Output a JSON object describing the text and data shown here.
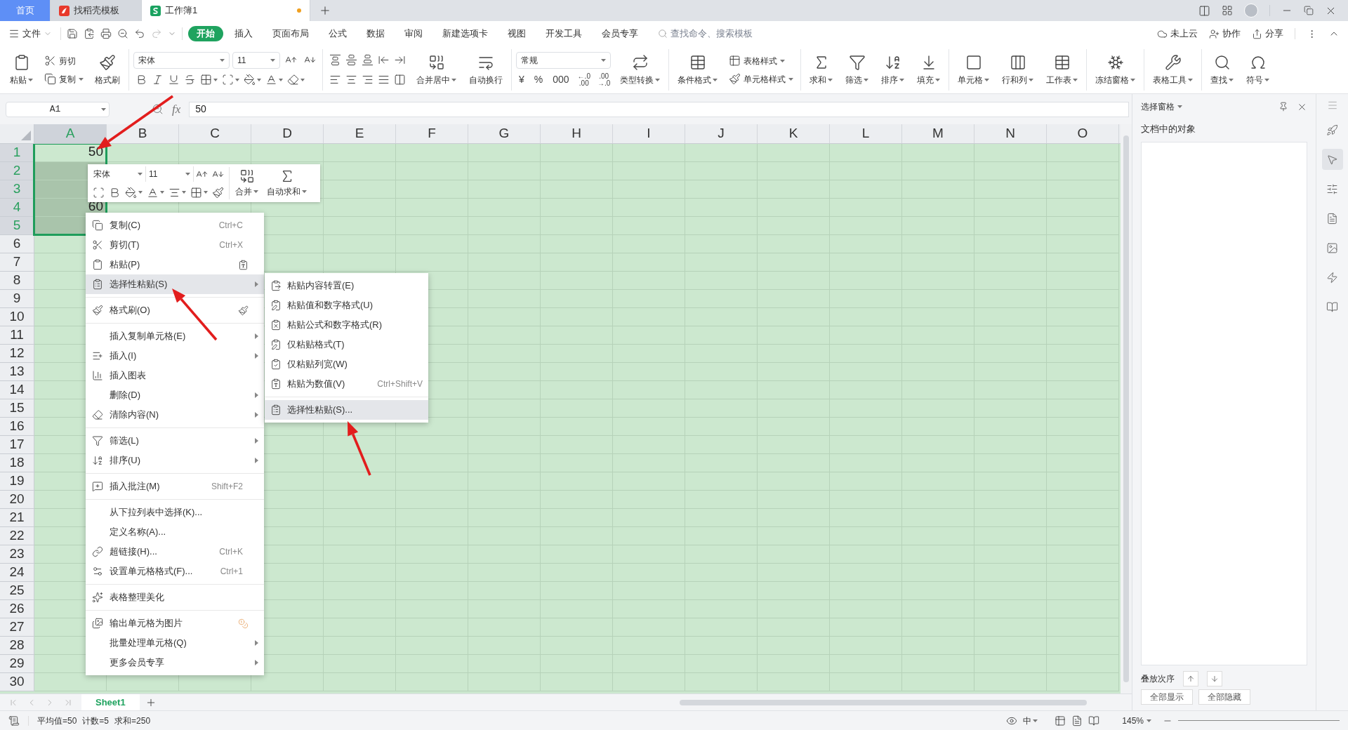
{
  "tabs": [
    {
      "label": "首页",
      "selected": false,
      "kind": "home"
    },
    {
      "label": "找稻壳模板",
      "selected": false,
      "kind": "docer"
    },
    {
      "label": "工作簿1",
      "selected": true,
      "kind": "sheet",
      "unsaved": true
    }
  ],
  "menu_bar": {
    "file": "文件",
    "tabs": [
      {
        "label": "开始",
        "selected": true
      },
      {
        "label": "插入",
        "selected": false
      },
      {
        "label": "页面布局",
        "selected": false
      },
      {
        "label": "公式",
        "selected": false
      },
      {
        "label": "数据",
        "selected": false
      },
      {
        "label": "审阅",
        "selected": false
      },
      {
        "label": "新建选项卡",
        "selected": false
      },
      {
        "label": "视图",
        "selected": false
      },
      {
        "label": "开发工具",
        "selected": false
      },
      {
        "label": "会员专享",
        "selected": false
      }
    ],
    "search": {
      "placeholder": "查找命令、搜索模板"
    },
    "actions": [
      "未上云",
      "协作",
      "分享"
    ]
  },
  "ribbon": {
    "clipboard": [
      {
        "label": "粘贴",
        "has_menu": true
      },
      {
        "label": "剪切",
        "has_menu": false
      },
      {
        "label": "复制",
        "has_menu": true
      },
      {
        "label": "格式刷",
        "has_menu": false
      }
    ],
    "font": {
      "name": "宋体",
      "size": "11"
    },
    "alignment": [
      {
        "label": "合并居中",
        "has_menu": true
      },
      {
        "label": "自动换行",
        "has_menu": false
      }
    ],
    "number": {
      "format": "常规",
      "symbols": [
        "¥",
        "%",
        "000"
      ],
      "decimals": [
        [
          "←.0",
          ".00"
        ],
        [
          ".00",
          "→.0"
        ]
      ],
      "convert": {
        "label": "类型转换",
        "has_menu": true
      }
    },
    "styles": [
      {
        "label": "条件格式",
        "has_menu": true
      },
      {
        "label": "表格样式",
        "has_menu": true
      },
      {
        "label": "单元格样式",
        "has_menu": true
      }
    ],
    "tool_groups": [
      [
        {
          "label": "求和",
          "has_menu": true
        },
        {
          "label": "筛选",
          "has_menu": true
        },
        {
          "label": "排序",
          "has_menu": true
        },
        {
          "label": "填充",
          "has_menu": true
        }
      ],
      [
        {
          "label": "单元格",
          "has_menu": true
        },
        {
          "label": "行和列",
          "has_menu": true
        },
        {
          "label": "工作表",
          "has_menu": true
        }
      ],
      [
        {
          "label": "冻结窗格",
          "has_menu": true
        }
      ],
      [
        {
          "label": "表格工具",
          "has_menu": true
        }
      ],
      [
        {
          "label": "查找",
          "has_menu": true
        },
        {
          "label": "符号",
          "has_menu": true
        }
      ]
    ]
  },
  "formula_bar": {
    "name_box": "A1",
    "function_label": "fx",
    "value": "50"
  },
  "columns": [
    {
      "label": "A",
      "selected": true
    },
    {
      "label": "B",
      "selected": false
    },
    {
      "label": "C",
      "selected": false
    },
    {
      "label": "D",
      "selected": false
    },
    {
      "label": "E",
      "selected": false
    },
    {
      "label": "F",
      "selected": false
    },
    {
      "label": "G",
      "selected": false
    },
    {
      "label": "H",
      "selected": false
    },
    {
      "label": "I",
      "selected": false
    },
    {
      "label": "J",
      "selected": false
    },
    {
      "label": "K",
      "selected": false
    },
    {
      "label": "L",
      "selected": false
    },
    {
      "label": "M",
      "selected": false
    },
    {
      "label": "N",
      "selected": false
    },
    {
      "label": "O",
      "selected": false
    }
  ],
  "rows": [
    {
      "label": "1",
      "selected": true,
      "cells": [
        "50"
      ]
    },
    {
      "label": "2",
      "selected": true
    },
    {
      "label": "3",
      "selected": true
    },
    {
      "label": "4",
      "selected": true,
      "cells": [
        "60"
      ]
    },
    {
      "label": "5",
      "selected": true
    },
    {
      "label": "6",
      "selected": false
    },
    {
      "label": "7",
      "selected": false
    },
    {
      "label": "8",
      "selected": false
    },
    {
      "label": "9",
      "selected": false
    },
    {
      "label": "10",
      "selected": false
    },
    {
      "label": "11",
      "selected": false
    },
    {
      "label": "12",
      "selected": false
    },
    {
      "label": "13",
      "selected": false
    },
    {
      "label": "14",
      "selected": false
    },
    {
      "label": "15",
      "selected": false
    },
    {
      "label": "16",
      "selected": false
    },
    {
      "label": "17",
      "selected": false
    },
    {
      "label": "18",
      "selected": false
    },
    {
      "label": "19",
      "selected": false
    },
    {
      "label": "20",
      "selected": false
    },
    {
      "label": "21",
      "selected": false
    },
    {
      "label": "22",
      "selected": false
    },
    {
      "label": "23",
      "selected": false
    },
    {
      "label": "24",
      "selected": false
    },
    {
      "label": "25",
      "selected": false
    },
    {
      "label": "26",
      "selected": false
    },
    {
      "label": "27",
      "selected": false
    },
    {
      "label": "28",
      "selected": false
    },
    {
      "label": "29",
      "selected": false
    },
    {
      "label": "30",
      "selected": false
    }
  ],
  "mini_toolbar": {
    "font": "宋体",
    "size": "11",
    "buttons": [
      {
        "label": "合并",
        "has_menu": true
      },
      {
        "label": "自动求和",
        "has_menu": true
      }
    ]
  },
  "context_menu": {
    "sections": [
      [
        {
          "label": "复制(C)",
          "shortcut": "Ctrl+C",
          "submenu": false,
          "selected": false
        },
        {
          "label": "剪切(T)",
          "shortcut": "Ctrl+X",
          "submenu": false,
          "selected": false
        },
        {
          "label": "粘贴(P)",
          "submenu": false,
          "selected": false
        },
        {
          "label": "选择性粘贴(S)",
          "submenu": true,
          "selected": true
        }
      ],
      [
        {
          "label": "格式刷(O)",
          "submenu": false,
          "selected": false
        }
      ],
      [
        {
          "label": "插入复制单元格(E)",
          "submenu": true,
          "selected": false
        },
        {
          "label": "插入(I)",
          "submenu": true,
          "selected": false
        },
        {
          "label": "插入图表",
          "submenu": false,
          "selected": false
        },
        {
          "label": "删除(D)",
          "submenu": true,
          "selected": false
        },
        {
          "label": "清除内容(N)",
          "submenu": true,
          "selected": false
        }
      ],
      [
        {
          "label": "筛选(L)",
          "submenu": true,
          "selected": false
        },
        {
          "label": "排序(U)",
          "submenu": true,
          "selected": false
        }
      ],
      [
        {
          "label": "插入批注(M)",
          "shortcut": "Shift+F2",
          "submenu": false,
          "selected": false
        }
      ],
      [
        {
          "label": "从下拉列表中选择(K)...",
          "submenu": false,
          "selected": false
        },
        {
          "label": "定义名称(A)...",
          "submenu": false,
          "selected": false
        },
        {
          "label": "超链接(H)...",
          "shortcut": "Ctrl+K",
          "submenu": false,
          "selected": false
        },
        {
          "label": "设置单元格格式(F)...",
          "shortcut": "Ctrl+1",
          "submenu": false,
          "selected": false
        }
      ],
      [
        {
          "label": "表格整理美化",
          "submenu": false,
          "selected": false
        }
      ],
      [
        {
          "label": "输出单元格为图片",
          "submenu": false,
          "selected": false
        },
        {
          "label": "批量处理单元格(Q)",
          "submenu": true,
          "selected": false
        },
        {
          "label": "更多会员专享",
          "submenu": true,
          "selected": false
        }
      ]
    ]
  },
  "submenu": {
    "sections": [
      [
        {
          "label": "粘贴内容转置(E)",
          "selected": false
        },
        {
          "label": "粘贴值和数字格式(U)",
          "selected": false
        },
        {
          "label": "粘贴公式和数字格式(R)",
          "selected": false
        },
        {
          "label": "仅粘贴格式(T)",
          "selected": false
        },
        {
          "label": "仅粘贴列宽(W)",
          "selected": false
        },
        {
          "label": "粘贴为数值(V)",
          "shortcut": "Ctrl+Shift+V",
          "selected": false
        }
      ],
      [
        {
          "label": "选择性粘贴(S)...",
          "selected": true
        }
      ]
    ]
  },
  "sheet_tabs": [
    {
      "label": "Sheet1",
      "selected": true
    }
  ],
  "selection_pane": {
    "title": "选择窗格",
    "heading": "文档中的对象",
    "order_label": "叠放次序",
    "buttons": [
      "全部显示",
      "全部隐藏"
    ]
  },
  "status_bar": {
    "stats": [
      "平均值=50",
      "计数=5",
      "求和=250"
    ],
    "input_mode": "中",
    "zoom": "145%"
  }
}
